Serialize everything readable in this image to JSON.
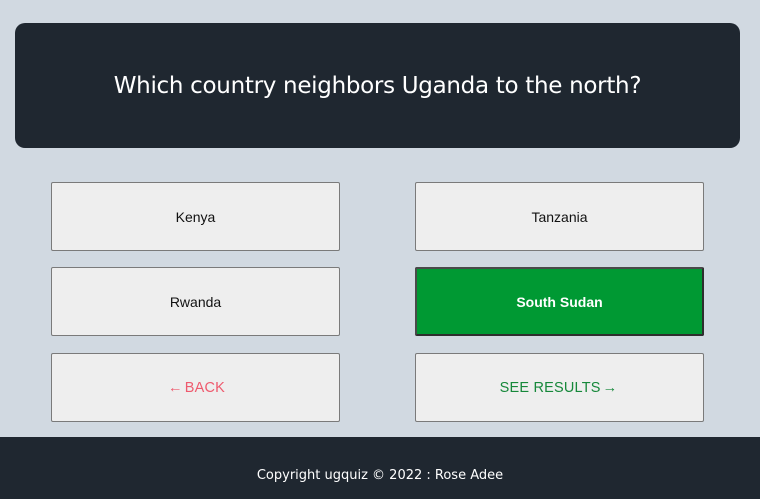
{
  "question": {
    "text": "Which country neighbors Uganda to the north?"
  },
  "answers": [
    {
      "label": "Kenya",
      "selected": false
    },
    {
      "label": "Tanzania",
      "selected": false
    },
    {
      "label": "Rwanda",
      "selected": false
    },
    {
      "label": "South Sudan",
      "selected": true
    }
  ],
  "nav": {
    "back_arrow": "←",
    "back_label": "BACK",
    "results_label": "SEE RESULTS",
    "results_arrow": "→"
  },
  "footer": {
    "copyright": "Copyright ugquiz © 2022 : Rose Adee"
  },
  "colors": {
    "background": "#d1d9e1",
    "card": "#1f2730",
    "selected": "#009933",
    "back": "#ee5a6e",
    "results": "#16883a"
  }
}
